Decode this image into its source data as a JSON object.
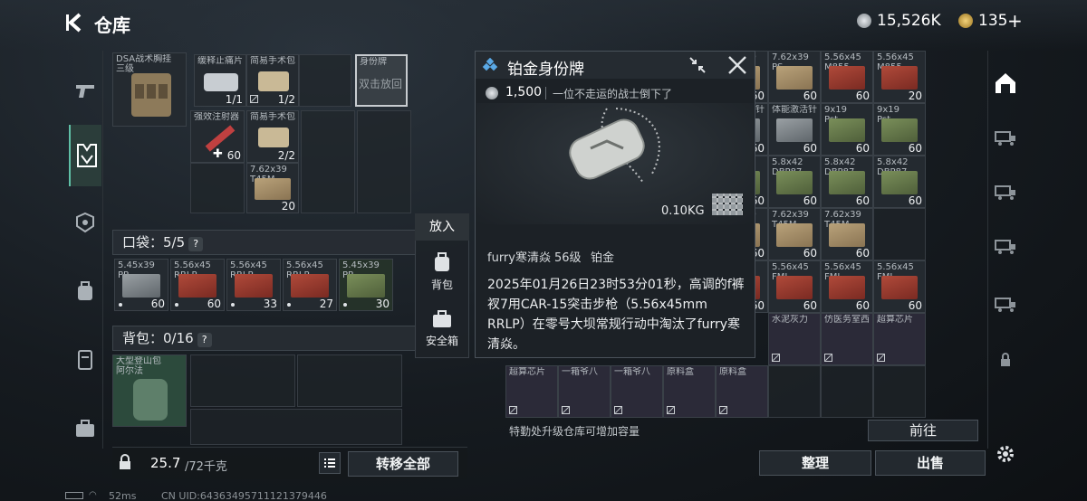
{
  "header": {
    "title": "仓库",
    "currency1": "15,526K",
    "currency2": "135",
    "plus": "+"
  },
  "left_items": [
    {
      "name": "DSA战术胸挂\n三级"
    },
    {
      "name": "缓释止痛片",
      "count": "1/1"
    },
    {
      "name": "简易手术包",
      "count": "1/2"
    },
    {
      "name": "身份牌",
      "sub": "双击放回"
    },
    {
      "name": "强效注射器",
      "count": "60"
    },
    {
      "name": "简易手术包",
      "count": "2/2"
    },
    {
      "name": "7.62x39\nT45M",
      "count": "20"
    }
  ],
  "pockets": {
    "label": "口袋：5/5",
    "help": "?",
    "items": [
      {
        "name": "5.45x39\nPP",
        "count": "60"
      },
      {
        "name": "5.56x45\nRRLP",
        "count": "60"
      },
      {
        "name": "5.56x45\nRRLP",
        "count": "33"
      },
      {
        "name": "5.56x45\nRRLP",
        "count": "27"
      },
      {
        "name": "5.45x39\nPP",
        "count": "30"
      }
    ]
  },
  "backpack": {
    "label": "背包：0/16",
    "help": "?",
    "item": "大型登山包\n阿尔法"
  },
  "weight": {
    "current": "25.7",
    "max": "/72千克"
  },
  "transfer_all": "转移全部",
  "put_menu": {
    "title": "放入",
    "backpack": "背包",
    "safebox": "安全箱"
  },
  "popup": {
    "title": "铂金身份牌",
    "price": "1,500",
    "desc": "一位不走运的战士倒下了",
    "weight": "0.10KG",
    "player": "furry寒清焱",
    "level": "56级",
    "rank": "铂金",
    "story": "2025年01月26日23时53分01秒，高调的f裤衩7用CAR-15突击步枪（5.56x45mm RRLP）在零号大坝常规行动中淘汰了furry寒清焱。"
  },
  "stash": [
    {
      "name": "7.62x39\nPS",
      "count": "60"
    },
    {
      "name": "7.62x39\nPS",
      "count": "60"
    },
    {
      "name": "5.56x45\nM855",
      "count": "60"
    },
    {
      "name": "5.56x45\nM855",
      "count": "20"
    },
    {
      "name": "体能激活针",
      "count": "60"
    },
    {
      "name": "体能激活针",
      "count": "60"
    },
    {
      "name": "9x19\nPst",
      "count": "60"
    },
    {
      "name": "9x19\nPst",
      "count": "60"
    },
    {
      "name": "5.8x42\nDBP87",
      "count": "60"
    },
    {
      "name": "5.8x42\nDBP87",
      "count": "60"
    },
    {
      "name": "5.8x42\nDBP87",
      "count": "60"
    },
    {
      "name": "5.8x42\nDBP87",
      "count": "60"
    },
    {
      "name": "7.62x39\nT45M",
      "count": "60"
    },
    {
      "name": "7.62x39\nT45M",
      "count": "60"
    },
    {
      "name": "7.62x39\nT45M",
      "count": "60"
    },
    {
      "name": "",
      "count": ""
    },
    {
      "name": "5.56x45\nFMJ",
      "count": "60"
    },
    {
      "name": "5.56x45\nFMJ",
      "count": "60"
    },
    {
      "name": "5.56x45\nFMJ",
      "count": "60"
    },
    {
      "name": "5.56x45\nFMJ",
      "count": "60"
    },
    {
      "name": "水泥灰力",
      "count": ""
    },
    {
      "name": "仿医务室西",
      "count": ""
    },
    {
      "name": "超算芯片",
      "count": ""
    },
    {
      "name": "超算芯片",
      "count": ""
    },
    {
      "name": "一箱爷八",
      "count": ""
    },
    {
      "name": "一箱爷八",
      "count": ""
    },
    {
      "name": "原料盒",
      "count": ""
    },
    {
      "name": "原料盒",
      "count": ""
    }
  ],
  "upgrade_hint": "特勤处升级仓库可增加容量",
  "goto": "前往",
  "sort": "整理",
  "sell": "出售",
  "status": {
    "ping": "52ms",
    "uid": "CN UID:64363495711121379446"
  }
}
